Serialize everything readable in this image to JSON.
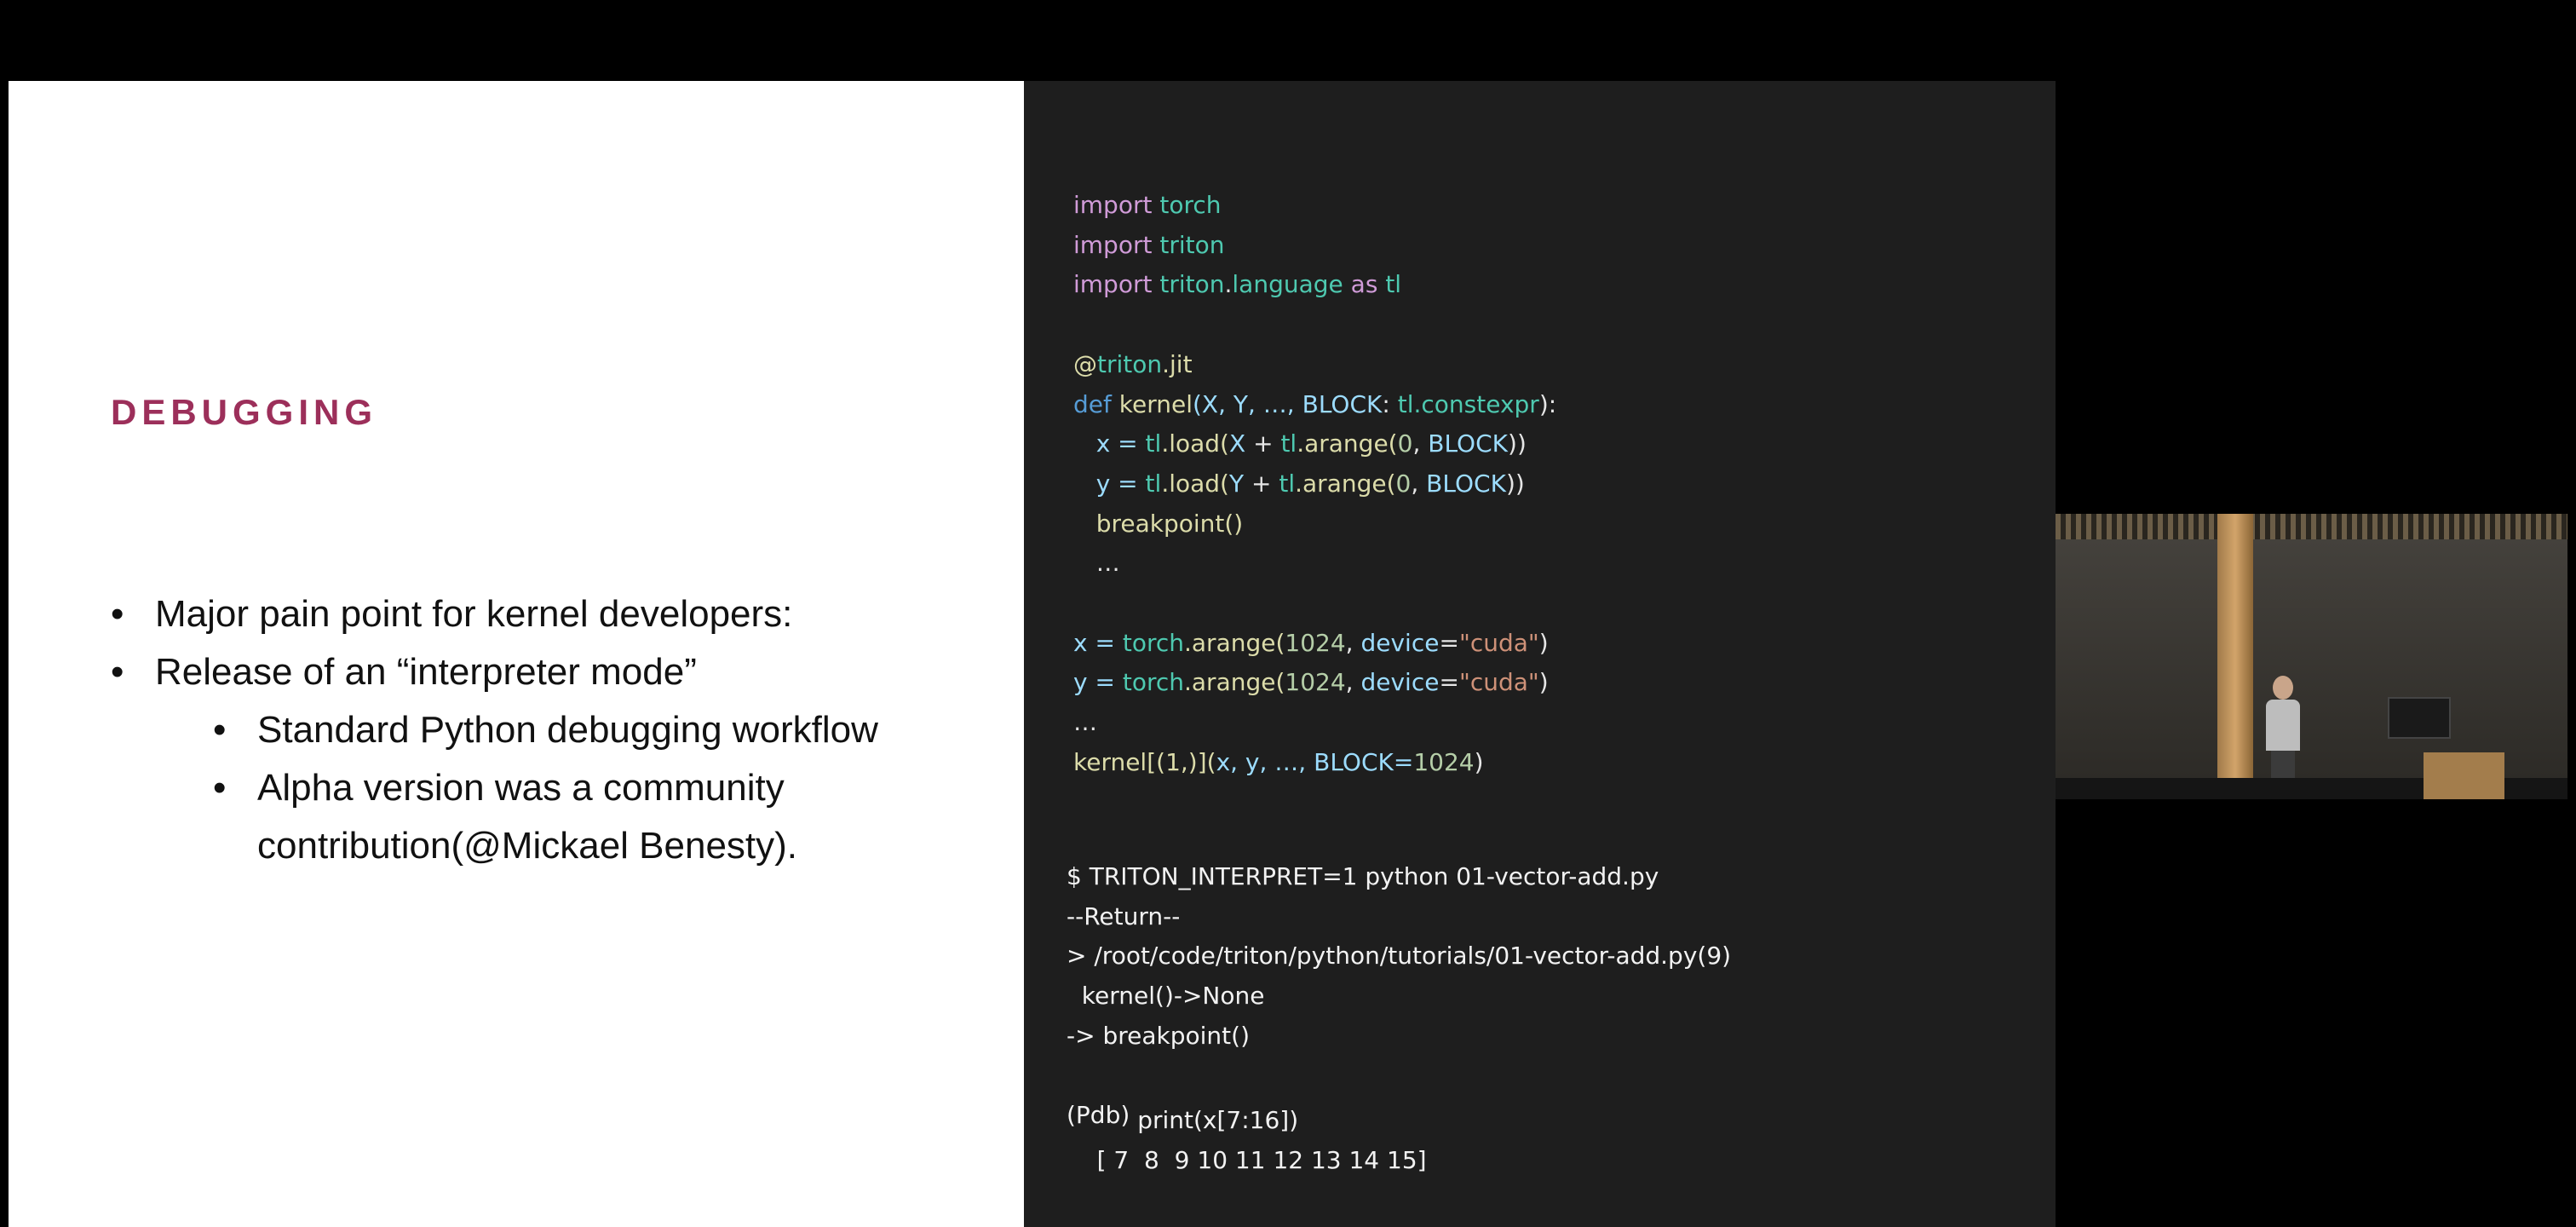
{
  "slide": {
    "title": "DEBUGGING",
    "bullets": [
      "Major pain point for kernel developers:",
      "Release of an “interpreter mode”"
    ],
    "sub_bullets": [
      "Standard Python debugging workflow",
      "Alpha version was a community",
      "contribution(@Mickael Benesty)."
    ]
  },
  "code": {
    "imports": {
      "kw_import": "import",
      "kw_as": "as",
      "m_torch": "torch",
      "m_triton": "triton",
      "m_language": "language",
      "m_tl": "tl",
      "dot": "."
    },
    "decorator": {
      "at": "@",
      "triton": "triton",
      "jit": ".jit"
    },
    "def_line": {
      "kw_def": "def",
      "name": "kernel",
      "args_a": "(X, Y, …, ",
      "block": "BLOCK",
      "colon": ": ",
      "tl": "tl",
      "constexpr": ".constexpr",
      "end": "):"
    },
    "body": {
      "x_assign": "x = ",
      "y_assign": "y = ",
      "tl": "tl",
      "load_open": ".load(",
      "X": "X",
      "Y": "Y",
      "plus": " + ",
      "arange": ".arange(",
      "zero": "0",
      "comma": ", ",
      "block": "BLOCK",
      "close": "))",
      "breakpoint": "breakpoint()",
      "ellipsis": "…"
    },
    "host": {
      "x_assign": "x = ",
      "y_assign": "y = ",
      "torch": "torch",
      "arange": ".arange(",
      "n1024": "1024",
      "comma": ", ",
      "device": "device",
      "eq": "=",
      "cuda": "\"cuda\"",
      "rparen": ")",
      "ellipsis": "…",
      "kernel": "kernel[(1,)](",
      "xy": "x, y, …, ",
      "block_eq": "BLOCK=",
      "block_val": "1024",
      "end": ")"
    },
    "terminal": [
      "$ TRITON_INTERPRET=1 python 01-vector-add.py",
      "--Return--",
      "> /root/code/triton/python/tutorials/01-vector-add.py(9)",
      "  kernel()->None",
      "-> breakpoint()"
    ],
    "pdb": {
      "prompt": "(Pdb)",
      "command": "print(x[7:16])",
      "output": "[ 7  8  9 10 11 12 13 14 15]"
    }
  },
  "colors": {
    "title": "#9c2f5a",
    "code_bg": "#1e1e1e",
    "keyword": "#d09bd8",
    "module": "#4ec9b0",
    "function": "#dcdcaa",
    "identifier": "#9cdcfe",
    "number": "#b5cea8",
    "string": "#ce9178"
  }
}
